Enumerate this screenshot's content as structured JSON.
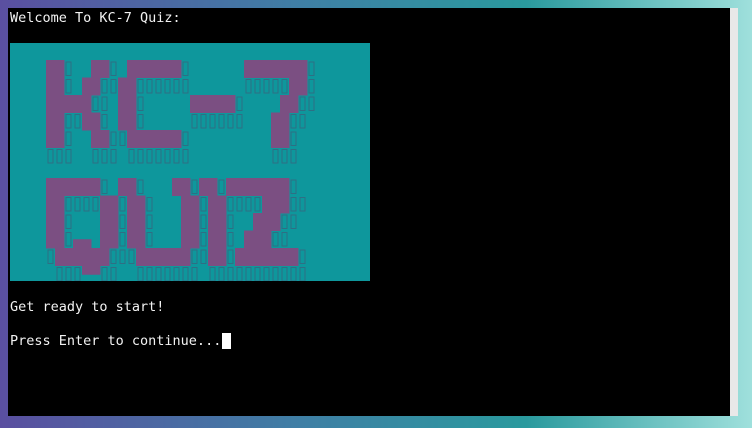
{
  "terminal": {
    "welcome": "Welcome To KC-7 Quiz:",
    "ready": "Get ready to start!",
    "prompt": "Press Enter to continue..."
  },
  "banner": {
    "text": "KC-7 QUIZ",
    "background_color": "#0e979c",
    "block_color": "#7b4f82",
    "shadow_color": "#2e6f84"
  }
}
